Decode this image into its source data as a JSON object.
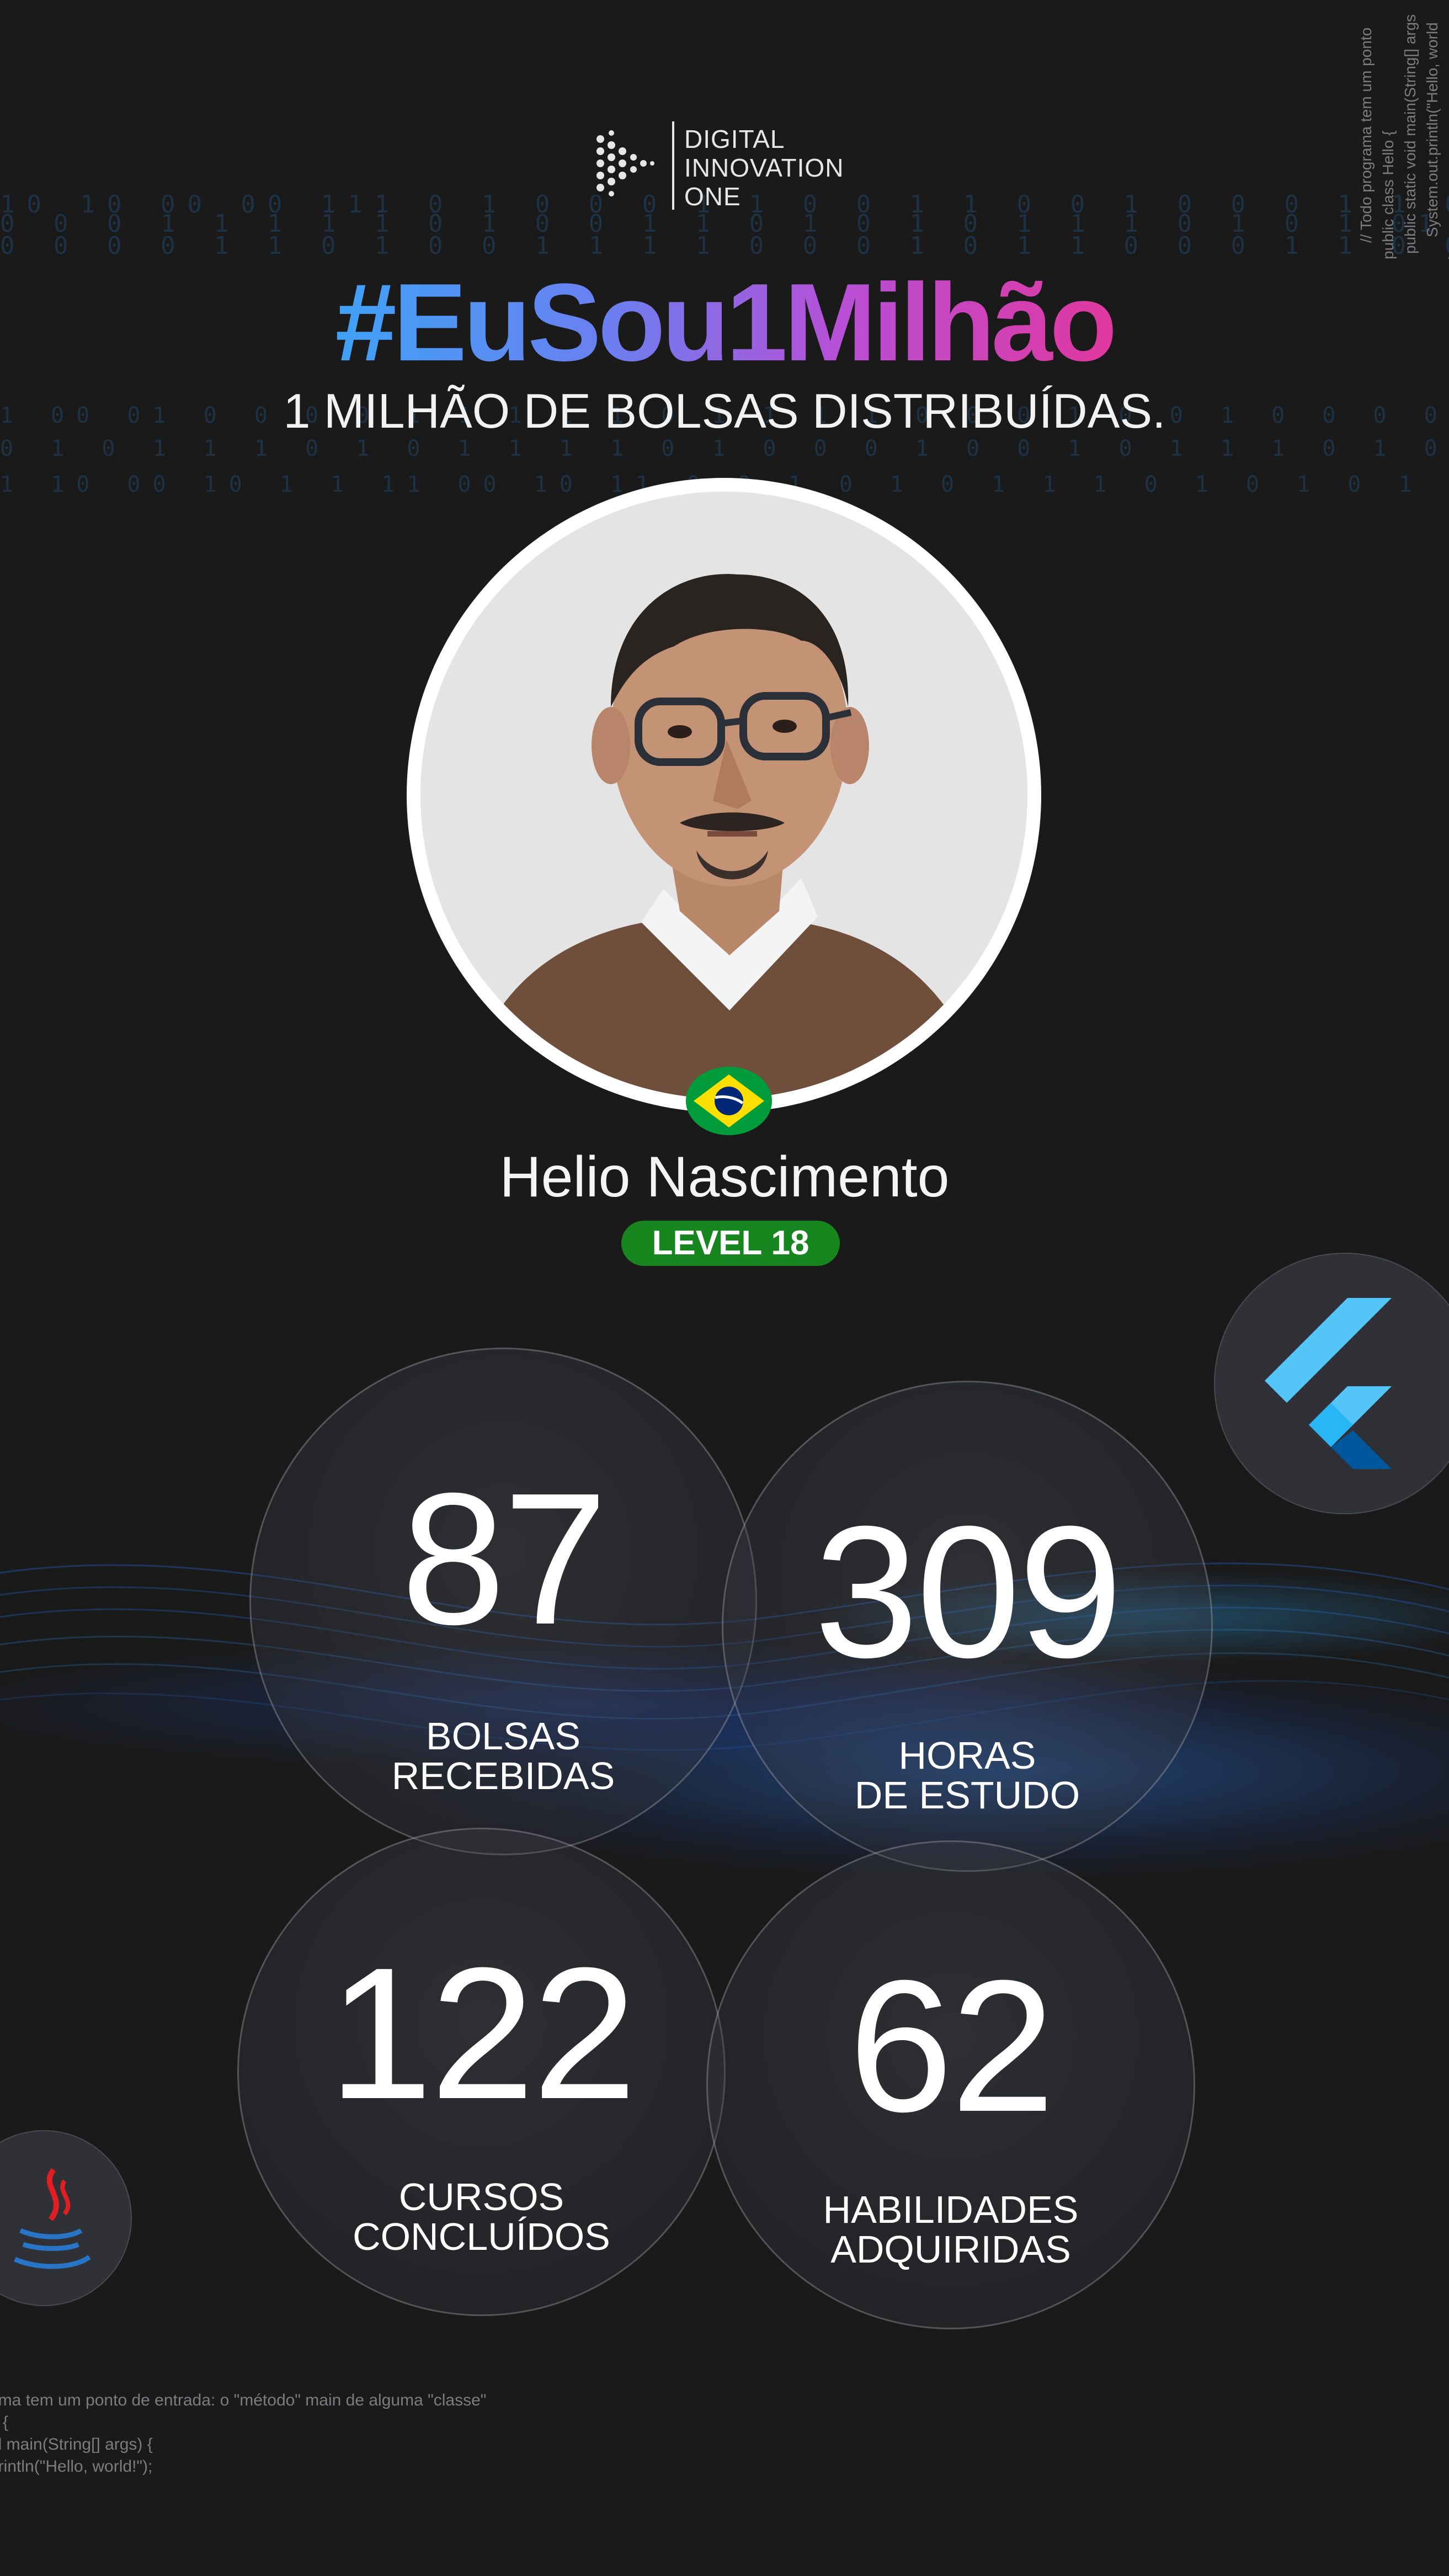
{
  "brand": {
    "logo_line1": "DIGITAL",
    "logo_line2": "INNOVATION",
    "logo_line3": "ONE"
  },
  "campaign": {
    "hashtag": "#EuSou1Milhão",
    "subtitle": "1 MILHÃO DE BOLSAS DISTRIBUÍDAS."
  },
  "profile": {
    "name": "Helio Nascimento",
    "level": "LEVEL 18",
    "country_flag": "brazil-flag-icon"
  },
  "stats": [
    {
      "value": "87",
      "label_line1": "BOLSAS",
      "label_line2": "RECEBIDAS"
    },
    {
      "value": "309",
      "label_line1": "HORAS",
      "label_line2": "DE ESTUDO"
    },
    {
      "value": "122",
      "label_line1": "CURSOS",
      "label_line2": "CONCLUÍDOS"
    },
    {
      "value": "62",
      "label_line1": "HABILIDADES",
      "label_line2": "ADQUIRIDAS"
    }
  ],
  "tech_icons": [
    "flutter-icon",
    "java-icon"
  ],
  "code_snippet_bottom": [
    "ama tem um ponto de entrada: o \"método\" main de alguma \"classe\"",
    "o {",
    "id main(String[] args) {",
    "println(\"Hello, world!\");"
  ],
  "code_snippet_right": [
    "// Todo programa tem um ponto",
    "public class Hello {",
    "public static void main(String[] args",
    "System.out.println(\"Hello, world",
    "}"
  ],
  "colors": {
    "background": "#1a1a1b",
    "hashtag_gradient_start": "#3fa2f6",
    "hashtag_gradient_end": "#e0389e",
    "level_badge": "#17861e"
  }
}
